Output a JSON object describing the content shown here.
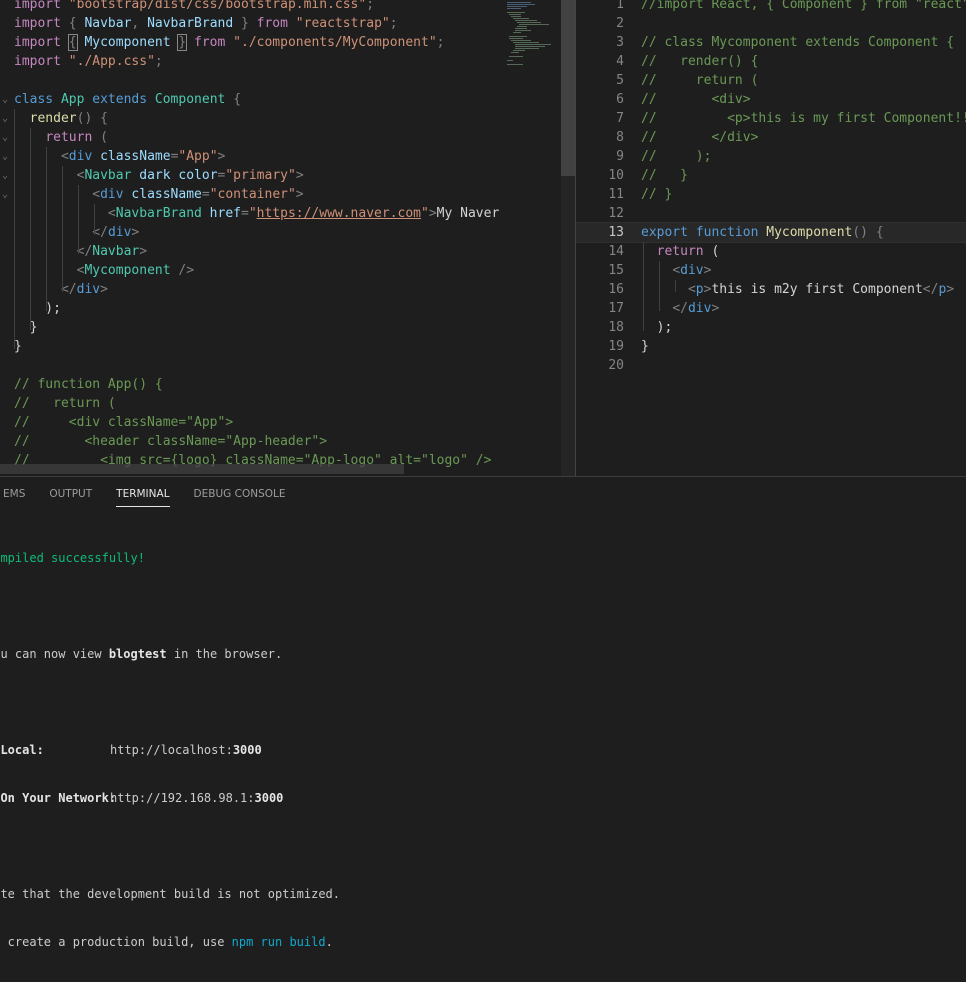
{
  "left_editor": {
    "lines": [
      [
        [
          "k",
          "import "
        ],
        [
          "s",
          "\"bootstrap/dist/css/bootstrap.min.css\""
        ],
        [
          "p",
          ";"
        ]
      ],
      [
        [
          "k",
          "import "
        ],
        [
          "p",
          "{ "
        ],
        [
          "v",
          "Navbar"
        ],
        [
          "p",
          ", "
        ],
        [
          "v",
          "NavbarBrand"
        ],
        [
          "p",
          " } "
        ],
        [
          "k",
          "from "
        ],
        [
          "s",
          "\"reactstrap\""
        ],
        [
          "p",
          ";"
        ]
      ],
      [
        [
          "k",
          "import "
        ],
        [
          "box",
          "{"
        ],
        [
          "p",
          " "
        ],
        [
          "v",
          "Mycomponent"
        ],
        [
          "p",
          " "
        ],
        [
          "box",
          "}"
        ],
        [
          "p",
          " "
        ],
        [
          "k",
          "from "
        ],
        [
          "s",
          "\"./components/MyComponent\""
        ],
        [
          "p",
          ";"
        ]
      ],
      [
        [
          "k",
          "import "
        ],
        [
          "s",
          "\"./App.css\""
        ],
        [
          "p",
          ";"
        ]
      ],
      [],
      [
        [
          "b",
          "class "
        ],
        [
          "t",
          "App "
        ],
        [
          "b",
          "extends "
        ],
        [
          "t",
          "Component "
        ],
        [
          "p",
          "{"
        ]
      ],
      [
        [
          "p",
          "  "
        ],
        [
          "f",
          "render"
        ],
        [
          "p",
          "() {"
        ]
      ],
      [
        [
          "p",
          "    "
        ],
        [
          "k",
          "return "
        ],
        [
          "p",
          "("
        ]
      ],
      [
        [
          "p",
          "      "
        ],
        [
          "p",
          "<"
        ],
        [
          "b",
          "div "
        ],
        [
          "v",
          "className"
        ],
        [
          "p",
          "="
        ],
        [
          "s",
          "\"App\""
        ],
        [
          "p",
          ">"
        ]
      ],
      [
        [
          "p",
          "        "
        ],
        [
          "p",
          "<"
        ],
        [
          "t",
          "Navbar "
        ],
        [
          "v",
          "dark "
        ],
        [
          "v",
          "color"
        ],
        [
          "p",
          "="
        ],
        [
          "s",
          "\"primary\""
        ],
        [
          "p",
          ">"
        ]
      ],
      [
        [
          "p",
          "          "
        ],
        [
          "p",
          "<"
        ],
        [
          "b",
          "div "
        ],
        [
          "v",
          "className"
        ],
        [
          "p",
          "="
        ],
        [
          "s",
          "\"container\""
        ],
        [
          "p",
          ">"
        ]
      ],
      [
        [
          "p",
          "            "
        ],
        [
          "p",
          "<"
        ],
        [
          "t",
          "NavbarBrand "
        ],
        [
          "v",
          "href"
        ],
        [
          "p",
          "="
        ],
        [
          "s",
          "\""
        ],
        [
          "su",
          "https://www.naver.com"
        ],
        [
          "s",
          "\""
        ],
        [
          "p",
          ">"
        ],
        [
          "d",
          "My Naver"
        ],
        [
          "p",
          "<"
        ]
      ],
      [
        [
          "p",
          "          "
        ],
        [
          "p",
          "</"
        ],
        [
          "b",
          "div"
        ],
        [
          "p",
          ">"
        ]
      ],
      [
        [
          "p",
          "        "
        ],
        [
          "p",
          "</"
        ],
        [
          "t",
          "Navbar"
        ],
        [
          "p",
          ">"
        ]
      ],
      [
        [
          "p",
          "        "
        ],
        [
          "p",
          "<"
        ],
        [
          "t",
          "Mycomponent "
        ],
        [
          "p",
          "/>"
        ]
      ],
      [
        [
          "p",
          "      "
        ],
        [
          "p",
          "</"
        ],
        [
          "b",
          "div"
        ],
        [
          "p",
          ">"
        ]
      ],
      [
        [
          "d",
          "    );"
        ]
      ],
      [
        [
          "d",
          "  }"
        ]
      ],
      [
        [
          "d",
          "}"
        ]
      ],
      [],
      [
        [
          "c",
          "// function App() {"
        ]
      ],
      [
        [
          "c",
          "//   return ("
        ]
      ],
      [
        [
          "c",
          "//     <div className=\"App\">"
        ]
      ],
      [
        [
          "c",
          "//       <header className=\"App-header\">"
        ]
      ],
      [
        [
          "c",
          "//         <img src={logo} className=\"App-logo\" alt=\"logo\" />"
        ]
      ]
    ]
  },
  "right_editor": {
    "line_numbers": [
      "1",
      "2",
      "3",
      "4",
      "5",
      "6",
      "7",
      "8",
      "9",
      "10",
      "11",
      "12",
      "13",
      "14",
      "15",
      "16",
      "17",
      "18",
      "19",
      "20"
    ],
    "active_line": "13",
    "lines": [
      [
        [
          "c",
          "//import React, { Component } from \"react\";"
        ]
      ],
      [],
      [
        [
          "c",
          "// class Mycomponent extends Component {"
        ]
      ],
      [
        [
          "c",
          "//   render() {"
        ]
      ],
      [
        [
          "c",
          "//     return ("
        ]
      ],
      [
        [
          "c",
          "//       <div>"
        ]
      ],
      [
        [
          "c",
          "//         <p>this is my first Component!!</p>"
        ]
      ],
      [
        [
          "c",
          "//       </div>"
        ]
      ],
      [
        [
          "c",
          "//     );"
        ]
      ],
      [
        [
          "c",
          "//   }"
        ]
      ],
      [
        [
          "c",
          "// }"
        ]
      ],
      [],
      [
        [
          "b",
          "export "
        ],
        [
          "b",
          "function "
        ],
        [
          "f",
          "Mycomponent"
        ],
        [
          "p",
          "() {"
        ]
      ],
      [
        [
          "p",
          "  "
        ],
        [
          "k",
          "return "
        ],
        [
          "d",
          "("
        ]
      ],
      [
        [
          "p",
          "    "
        ],
        [
          "p",
          "<"
        ],
        [
          "b",
          "div"
        ],
        [
          "p",
          ">"
        ]
      ],
      [
        [
          "p",
          "      "
        ],
        [
          "p",
          "<"
        ],
        [
          "b",
          "p"
        ],
        [
          "p",
          ">"
        ],
        [
          "d",
          "this is m2y first Component"
        ],
        [
          "p",
          "</"
        ],
        [
          "b",
          "p"
        ],
        [
          "p",
          ">"
        ]
      ],
      [
        [
          "p",
          "    "
        ],
        [
          "p",
          "</"
        ],
        [
          "b",
          "div"
        ],
        [
          "p",
          ">"
        ]
      ],
      [
        [
          "d",
          "  );"
        ]
      ],
      [
        [
          "d",
          "}"
        ]
      ],
      []
    ]
  },
  "panel": {
    "tabs": [
      "EMS",
      "OUTPUT",
      "TERMINAL",
      "DEBUG CONSOLE"
    ],
    "active_tab": "TERMINAL",
    "terminal": {
      "compiled": "Compiled successfully!",
      "view_prefix": "You can now view ",
      "app_name": "blogtest",
      "view_suffix": " in the browser.",
      "local_label": "  Local:",
      "local_url_base": "http://localhost:",
      "local_port": "3000",
      "network_label": "  On Your Network:",
      "network_url_base": "http://192.168.98.1:",
      "network_port": "3000",
      "note": "Note that the development build is not optimized.",
      "build_prefix": "To create a production build, use ",
      "build_cmd": "npm run build",
      "build_suffix": "."
    }
  }
}
